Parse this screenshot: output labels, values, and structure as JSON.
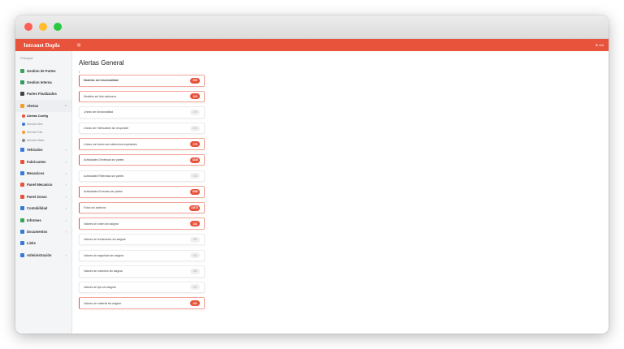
{
  "app": {
    "brand": "Intranet Dopla",
    "menu_icon": "grid-icon",
    "user": "⊕ GA"
  },
  "sidebar": {
    "section": "Principal",
    "items": [
      {
        "label": "Gestion de Partes",
        "icon": "folder-icon",
        "color": "#3aa55a",
        "chevron": false
      },
      {
        "label": "Gestion Interna",
        "icon": "id-card-icon",
        "color": "#2e9c5a",
        "chevron": false
      },
      {
        "label": "Partes Finalizados",
        "icon": "stack-icon",
        "color": "#444444",
        "chevron": false
      },
      {
        "label": "Alertas",
        "icon": "bell-icon",
        "color": "#f0a030",
        "chevron": true,
        "chevron_char": "^"
      }
    ],
    "alert_sub": [
      {
        "label": "Alertas Config",
        "color": "#e8533c",
        "active": true
      },
      {
        "label": "Alertas Mec",
        "color": "#3a78d8",
        "active": false
      },
      {
        "label": "Alertas Fab",
        "color": "#f0a030",
        "active": false
      },
      {
        "label": "Alertas Maut",
        "color": "#888888",
        "active": false
      }
    ],
    "more_items": [
      {
        "label": "Vehiculos",
        "icon": "truck-icon",
        "color": "#3a78d8",
        "chevron_char": "›"
      },
      {
        "label": "Fabricantes",
        "icon": "factory-icon",
        "color": "#e8533c",
        "chevron_char": "›"
      },
      {
        "label": "Mecanicos",
        "icon": "wrench-icon",
        "color": "#3a78d8",
        "chevron_char": "›"
      },
      {
        "label": "Panel Mecanico",
        "icon": "panel-icon",
        "color": "#e8533c",
        "chevron_char": "›"
      },
      {
        "label": "Panel Zonas",
        "icon": "map-icon",
        "color": "#e8533c",
        "chevron_char": "›"
      },
      {
        "label": "Contabilidad",
        "icon": "calculator-icon",
        "color": "#3a78d8",
        "chevron_char": "›"
      },
      {
        "label": "Informes",
        "icon": "report-icon",
        "color": "#3aa55a",
        "chevron_char": "›"
      },
      {
        "label": "Documentos",
        "icon": "document-icon",
        "color": "#3a78d8",
        "chevron_char": "›"
      },
      {
        "label": "Links",
        "icon": "link-icon",
        "color": "#3a78d8",
        "chevron_char": ""
      },
      {
        "label": "Administración",
        "icon": "settings-icon",
        "color": "#3a78d8",
        "chevron_char": "›"
      }
    ]
  },
  "main": {
    "title": "Alertas General",
    "cursor": "I",
    "alerts": [
      {
        "label": "Modelos sin funcionalidad",
        "count": "292",
        "hot": true,
        "strong": true
      },
      {
        "label": "Modelos sin foto cabecera",
        "count": "115",
        "hot": true,
        "strong": false
      },
      {
        "label": "Lineas sin funcionalidad",
        "count": "192",
        "hot": false,
        "strong": false
      },
      {
        "label": "Lineas sin Fabricantes sin responder",
        "count": "202",
        "hot": false,
        "strong": false
      },
      {
        "label": "Lineas con todos sus cabezeros especiales",
        "count": "176",
        "hot": true,
        "strong": false
      },
      {
        "label": "Actividades Genéricas sin partes",
        "count": "1445",
        "hot": true,
        "strong": false
      },
      {
        "label": "Actividades Retenidas sin partes",
        "count": "192",
        "hot": false,
        "strong": false
      },
      {
        "label": "Actividades Erróneas sin partes",
        "count": "1083",
        "hot": true,
        "strong": false
      },
      {
        "label": "Fotos sin archivos",
        "count": "14372",
        "hot": true,
        "strong": false
      },
      {
        "label": "Valores de orden sin asignar",
        "count": "131",
        "hot": true,
        "strong": false
      },
      {
        "label": "Valores de terminación sin asignar",
        "count": "182",
        "hot": false,
        "strong": false
      },
      {
        "label": "Valores de seguridad sin asignar",
        "count": "184",
        "hot": false,
        "strong": false
      },
      {
        "label": "Valores de controles sin asignar",
        "count": "182",
        "hot": false,
        "strong": false
      },
      {
        "label": "Valores de tipo sin asignar",
        "count": "102",
        "hot": false,
        "strong": false
      },
      {
        "label": "Valores de material sin asignar",
        "count": "131",
        "hot": true,
        "strong": false
      }
    ]
  }
}
